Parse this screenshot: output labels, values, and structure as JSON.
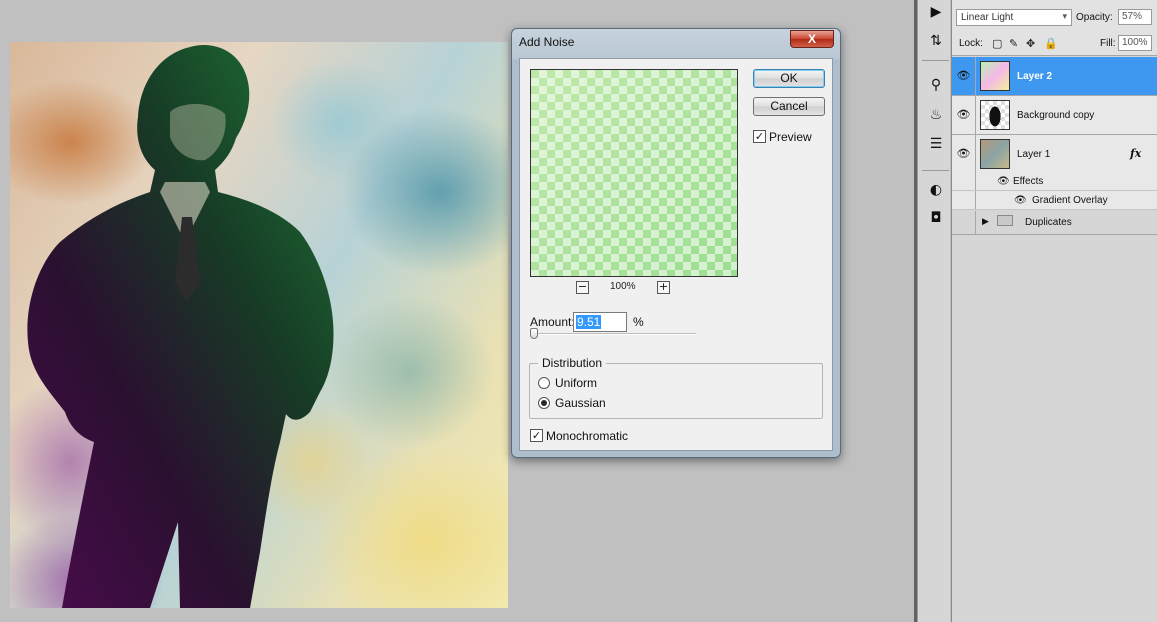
{
  "dialog": {
    "title": "Add Noise",
    "close_label": "X",
    "ok_label": "OK",
    "cancel_label": "Cancel",
    "preview_label": "Preview",
    "preview_checked": "✓",
    "zoom_out_label": "−",
    "zoom_in_label": "+",
    "zoom_level": "100%",
    "amount_label": "Amount:",
    "amount_value": "9.51",
    "amount_unit": "%",
    "amount_slider_fraction": 0.0238,
    "distribution_label": "Distribution",
    "uniform_label": "Uniform",
    "gaussian_label": "Gaussian",
    "monochromatic_label": "Monochromatic",
    "monochromatic_checked": "✓"
  },
  "tools": [
    {
      "icon": "play-icon",
      "glyph": "▶"
    },
    {
      "icon": "history-icon",
      "glyph": "⇅"
    },
    {
      "icon": "brush-settings-icon",
      "glyph": "⚲"
    },
    {
      "icon": "clone-source-icon",
      "glyph": "♨"
    },
    {
      "icon": "tool-presets-icon",
      "glyph": "☰"
    },
    {
      "icon": "adjustments-icon",
      "glyph": "◐"
    },
    {
      "icon": "masks-icon",
      "glyph": "◘"
    }
  ],
  "layers_panel": {
    "blend_mode": "Linear Light",
    "opacity_label": "Opacity:",
    "opacity_value": "57%",
    "lock_label": "Lock:",
    "fill_label": "Fill:",
    "fill_value": "100%",
    "layers": [
      {
        "name": "Layer 2",
        "selected": true,
        "visible": true
      },
      {
        "name": "Background copy",
        "selected": false,
        "visible": true
      },
      {
        "name": "Layer 1",
        "selected": false,
        "visible": true,
        "fx": "fx"
      }
    ],
    "effects_label": "Effects",
    "gradient_overlay_label": "Gradient Overlay",
    "group_name": "Duplicates",
    "eye_glyph": "👁",
    "triangle_glyph": "▶"
  },
  "colors": {
    "selection": "#3f98ef",
    "dialog_frame": "#aebecc",
    "close_button": "#c9452f"
  }
}
